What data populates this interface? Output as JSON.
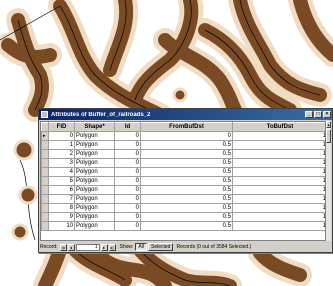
{
  "window": {
    "title": "Attributes of Buffer_of_railroads_2",
    "minimize_glyph": "_",
    "maximize_glyph": "□",
    "close_glyph": "×"
  },
  "table": {
    "columns": [
      "FID",
      "Shape*",
      "Id",
      "FromBufDst",
      "ToBufDst"
    ],
    "rows": [
      [
        "0",
        "Polygon",
        "0",
        "0",
        "1"
      ],
      [
        "1",
        "Polygon",
        "0",
        "0.5",
        "1"
      ],
      [
        "2",
        "Polygon",
        "0",
        "0.5",
        "1"
      ],
      [
        "3",
        "Polygon",
        "0",
        "0.5",
        "1"
      ],
      [
        "4",
        "Polygon",
        "0",
        "0.5",
        "1"
      ],
      [
        "5",
        "Polygon",
        "0",
        "0.5",
        "1"
      ],
      [
        "6",
        "Polygon",
        "0",
        "0.5",
        "1"
      ],
      [
        "7",
        "Polygon",
        "0",
        "0.5",
        "1"
      ],
      [
        "8",
        "Polygon",
        "0",
        "0.5",
        "1"
      ],
      [
        "9",
        "Polygon",
        "0",
        "0.5",
        "1"
      ],
      [
        "10",
        "Polygon",
        "0",
        "0.5",
        "1"
      ]
    ],
    "current_row_marker": "▸"
  },
  "status": {
    "record_label": "Record:",
    "record_value": "1",
    "first_glyph": "|◂",
    "prev_glyph": "◂",
    "next_glyph": "▸",
    "last_glyph": "▸|",
    "show_label": "Show:",
    "all_button": "All",
    "selected_button": "Selected",
    "records_text": "Records (0 out of 3584 Selected.)"
  },
  "scrollbar": {
    "up_glyph": "▴"
  },
  "colors": {
    "buffer_fill": "#7a4a24",
    "buffer_edge": "#f0dcc3",
    "railroad_line": "#000000",
    "title_bar_start": "#0a246a",
    "title_bar_end": "#3a6ea5"
  }
}
